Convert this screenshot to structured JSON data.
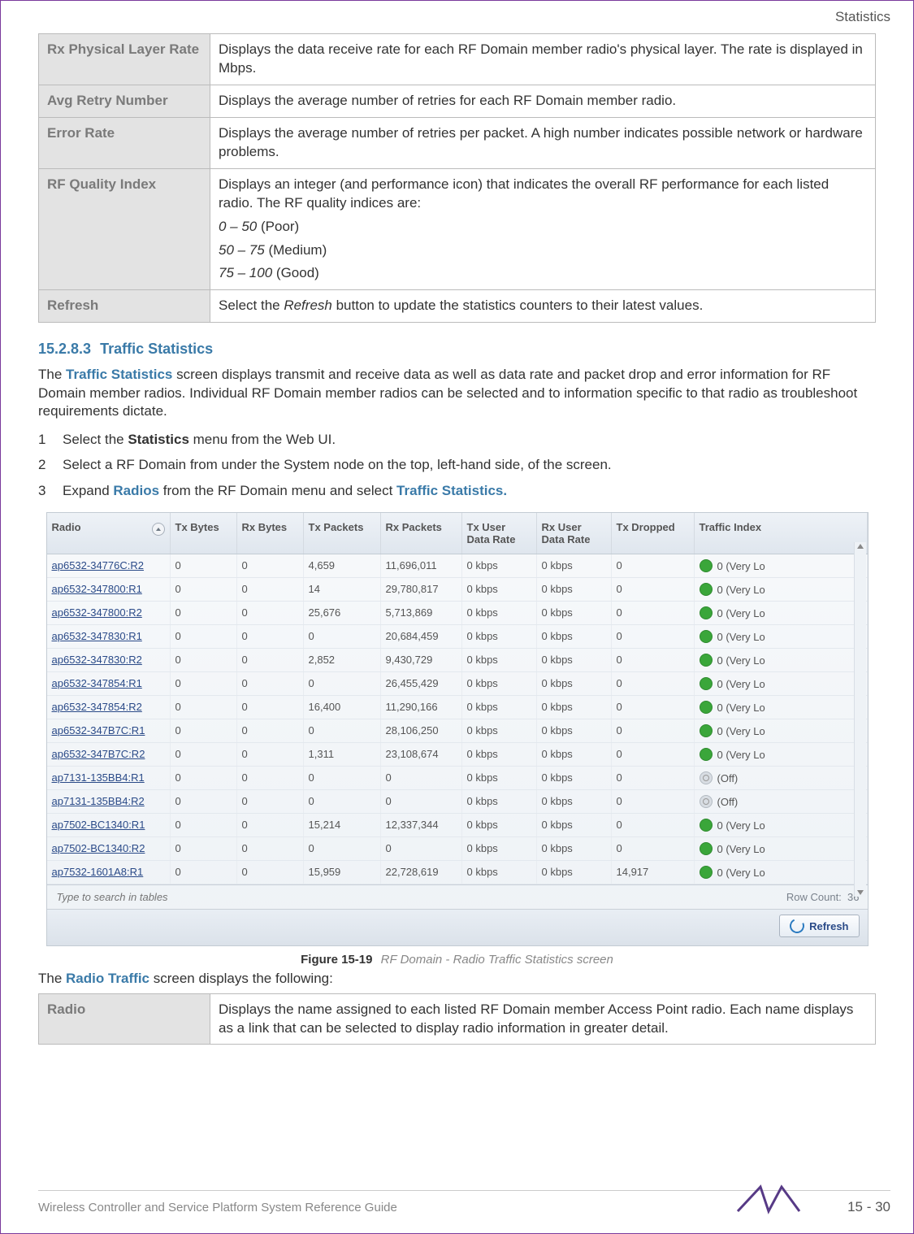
{
  "header": {
    "section": "Statistics"
  },
  "top_table": [
    {
      "label": "Rx Physical Layer Rate",
      "desc": "Displays the data receive rate for each RF Domain member radio's physical layer. The rate is displayed in Mbps."
    },
    {
      "label": "Avg Retry Number",
      "desc": "Displays the average number of retries for each RF Domain member radio."
    },
    {
      "label": "Error Rate",
      "desc": "Displays the average number of retries per packet. A high number indicates possible network or hardware problems."
    },
    {
      "label": "RF Quality Index",
      "desc": "Displays an integer (and performance icon) that indicates the overall RF performance for each listed radio. The RF quality indices are:",
      "ranges": [
        {
          "range": "0 – 50",
          "label": " (Poor)"
        },
        {
          "range": "50 – 75",
          "label": " (Medium)"
        },
        {
          "range": "75 – 100",
          "label": " (Good)"
        }
      ]
    },
    {
      "label": "Refresh",
      "desc_pre": "Select the ",
      "desc_em": "Refresh",
      "desc_post": " button to update the statistics counters to their latest values."
    }
  ],
  "section": {
    "number": "15.2.8.3",
    "title": "Traffic Statistics"
  },
  "intro": {
    "pre": "The ",
    "bold1": "Traffic Statistics",
    "post": " screen displays transmit and receive data as well as data rate and packet drop and error information for RF Domain member radios. Individual RF Domain member radios can be selected and to information specific to that radio as troubleshoot requirements dictate."
  },
  "steps": [
    {
      "n": "1",
      "pre": "Select the ",
      "b": "Statistics",
      "post": " menu from the Web UI."
    },
    {
      "n": "2",
      "pre": "Select a RF Domain from under the System node on the top, left-hand side, of the screen.",
      "b": "",
      "post": ""
    },
    {
      "n": "3",
      "pre": "Expand ",
      "b": "Radios",
      "mid": " from the RF Domain menu and select ",
      "b2": "Traffic Statistics.",
      "post": ""
    }
  ],
  "grid": {
    "headers": [
      "Radio",
      "Tx Bytes",
      "Rx Bytes",
      "Tx Packets",
      "Rx Packets",
      "Tx User Data Rate",
      "Rx User Data Rate",
      "Tx Dropped",
      "Traffic Index"
    ],
    "rows": [
      {
        "r": "ap6532-34776C:R2",
        "txb": "0",
        "rxb": "0",
        "txp": "4,659",
        "rxp": "11,696,011",
        "txr": "0 kbps",
        "rxr": "0 kbps",
        "txd": "0",
        "ti": "0 (Very Lo",
        "ico": "green"
      },
      {
        "r": "ap6532-347800:R1",
        "txb": "0",
        "rxb": "0",
        "txp": "14",
        "rxp": "29,780,817",
        "txr": "0 kbps",
        "rxr": "0 kbps",
        "txd": "0",
        "ti": "0 (Very Lo",
        "ico": "green"
      },
      {
        "r": "ap6532-347800:R2",
        "txb": "0",
        "rxb": "0",
        "txp": "25,676",
        "rxp": "5,713,869",
        "txr": "0 kbps",
        "rxr": "0 kbps",
        "txd": "0",
        "ti": "0 (Very Lo",
        "ico": "green"
      },
      {
        "r": "ap6532-347830:R1",
        "txb": "0",
        "rxb": "0",
        "txp": "0",
        "rxp": "20,684,459",
        "txr": "0 kbps",
        "rxr": "0 kbps",
        "txd": "0",
        "ti": "0 (Very Lo",
        "ico": "green"
      },
      {
        "r": "ap6532-347830:R2",
        "txb": "0",
        "rxb": "0",
        "txp": "2,852",
        "rxp": "9,430,729",
        "txr": "0 kbps",
        "rxr": "0 kbps",
        "txd": "0",
        "ti": "0 (Very Lo",
        "ico": "green"
      },
      {
        "r": "ap6532-347854:R1",
        "txb": "0",
        "rxb": "0",
        "txp": "0",
        "rxp": "26,455,429",
        "txr": "0 kbps",
        "rxr": "0 kbps",
        "txd": "0",
        "ti": "0 (Very Lo",
        "ico": "green"
      },
      {
        "r": "ap6532-347854:R2",
        "txb": "0",
        "rxb": "0",
        "txp": "16,400",
        "rxp": "11,290,166",
        "txr": "0 kbps",
        "rxr": "0 kbps",
        "txd": "0",
        "ti": "0 (Very Lo",
        "ico": "green"
      },
      {
        "r": "ap6532-347B7C:R1",
        "txb": "0",
        "rxb": "0",
        "txp": "0",
        "rxp": "28,106,250",
        "txr": "0 kbps",
        "rxr": "0 kbps",
        "txd": "0",
        "ti": "0 (Very Lo",
        "ico": "green"
      },
      {
        "r": "ap6532-347B7C:R2",
        "txb": "0",
        "rxb": "0",
        "txp": "1,311",
        "rxp": "23,108,674",
        "txr": "0 kbps",
        "rxr": "0 kbps",
        "txd": "0",
        "ti": "0 (Very Lo",
        "ico": "green"
      },
      {
        "r": "ap7131-135BB4:R1",
        "txb": "0",
        "rxb": "0",
        "txp": "0",
        "rxp": "0",
        "txr": "0 kbps",
        "rxr": "0 kbps",
        "txd": "0",
        "ti": "(Off)",
        "ico": "grey"
      },
      {
        "r": "ap7131-135BB4:R2",
        "txb": "0",
        "rxb": "0",
        "txp": "0",
        "rxp": "0",
        "txr": "0 kbps",
        "rxr": "0 kbps",
        "txd": "0",
        "ti": "(Off)",
        "ico": "grey"
      },
      {
        "r": "ap7502-BC1340:R1",
        "txb": "0",
        "rxb": "0",
        "txp": "15,214",
        "rxp": "12,337,344",
        "txr": "0 kbps",
        "rxr": "0 kbps",
        "txd": "0",
        "ti": "0 (Very Lo",
        "ico": "green"
      },
      {
        "r": "ap7502-BC1340:R2",
        "txb": "0",
        "rxb": "0",
        "txp": "0",
        "rxp": "0",
        "txr": "0 kbps",
        "rxr": "0 kbps",
        "txd": "0",
        "ti": "0 (Very Lo",
        "ico": "green"
      },
      {
        "r": "ap7532-1601A8:R1",
        "txb": "0",
        "rxb": "0",
        "txp": "15,959",
        "rxp": "22,728,619",
        "txr": "0 kbps",
        "rxr": "0 kbps",
        "txd": "14,917",
        "ti": "0 (Very Lo",
        "ico": "green"
      }
    ],
    "search_placeholder": "Type to search in tables",
    "rowcount_label": "Row Count:",
    "rowcount_value": "36",
    "refresh": "Refresh"
  },
  "figure": {
    "label": "Figure 15-19",
    "desc": "RF Domain - Radio Traffic Statistics screen"
  },
  "after_fig": {
    "pre": "The ",
    "b": "Radio Traffic",
    "post": " screen displays the following:"
  },
  "bottom_table": {
    "label": "Radio",
    "desc": "Displays the name assigned to each listed RF Domain member Access Point radio. Each name displays as a link that can be selected to display radio information in greater detail."
  },
  "footer": {
    "guide": "Wireless Controller and Service Platform System Reference Guide",
    "page": "15 - 30"
  }
}
